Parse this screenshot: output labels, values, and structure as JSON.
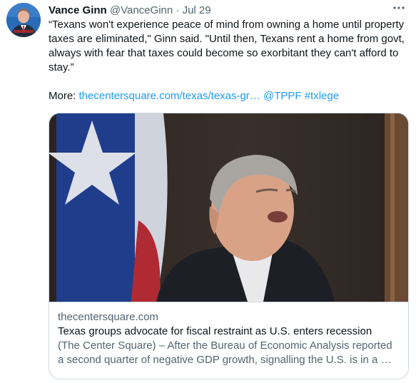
{
  "tweet": {
    "author_name": "Vance Ginn",
    "author_handle": "@VanceGinn",
    "separator": "·",
    "date": "Jul 29",
    "more_icon": "more-horizontal-icon",
    "text": "“Texans won't experience peace of mind from owning a home until property taxes are eliminated,\" Ginn said. \"Until then, Texans rent a home from govt, always with fear that taxes could become so exorbitant they can't afford to stay.”",
    "more_label": "More:",
    "link_url": "thecentersquare.com/texas/texas-gr…",
    "mention": "@TPPF",
    "hashtag": "#txlege"
  },
  "card": {
    "domain": "thecentersquare.com",
    "title": "Texas groups advocate for fiscal restraint as U.S. enters recession",
    "description": "(The Center Square) – After the Bureau of Economic Analysis reported a second quarter of negative GDP growth, signalling the U.S. is in a …"
  },
  "colors": {
    "link": "#1d9bf0",
    "text": "#0f1419",
    "secondary": "#536471",
    "border": "#cfd9de"
  }
}
